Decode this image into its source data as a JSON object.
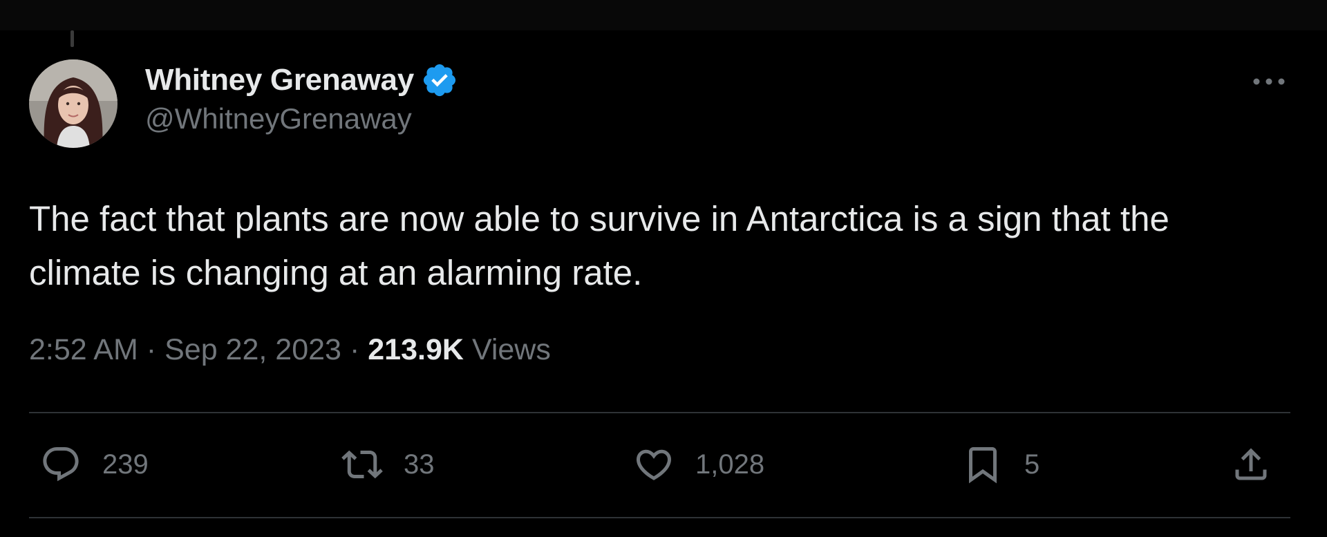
{
  "tweet": {
    "author": {
      "display_name": "Whitney Grenaway",
      "handle": "@WhitneyGrenaway",
      "verified": true,
      "avatar_icon": "profile-photo"
    },
    "text": "The fact that plants are now able to survive in Antarctica is a sign that the climate is changing at an alarming rate.",
    "time": "2:52 AM",
    "date": "Sep 22, 2023",
    "separator": "·",
    "views_count": "213.9K",
    "views_label": "Views",
    "more_icon": "more-horizontal-icon",
    "actions": {
      "reply": {
        "icon": "reply-icon",
        "count": "239"
      },
      "retweet": {
        "icon": "retweet-icon",
        "count": "33"
      },
      "like": {
        "icon": "heart-icon",
        "count": "1,028"
      },
      "bookmark": {
        "icon": "bookmark-icon",
        "count": "5"
      },
      "share": {
        "icon": "share-icon"
      }
    }
  },
  "colors": {
    "background": "#000000",
    "text_primary": "#e7e9ea",
    "text_secondary": "#71767b",
    "divider": "#2f3336",
    "verified_blue": "#1d9bf0"
  }
}
